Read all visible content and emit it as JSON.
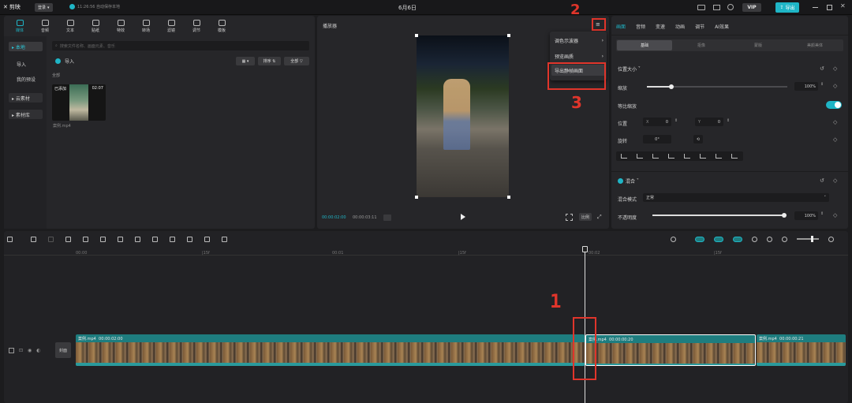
{
  "app": {
    "logo": "剪映",
    "user": "登录",
    "status": "11:26:56 自动保存本地",
    "title": "6月6日",
    "vip": "VIP",
    "export": "导出"
  },
  "media_tabs": [
    {
      "id": "media",
      "label": "媒体"
    },
    {
      "id": "audio",
      "label": "音频"
    },
    {
      "id": "text",
      "label": "文本"
    },
    {
      "id": "sticker",
      "label": "贴纸"
    },
    {
      "id": "effects",
      "label": "特效"
    },
    {
      "id": "transition",
      "label": "转场"
    },
    {
      "id": "filter",
      "label": "滤镜"
    },
    {
      "id": "adjust",
      "label": "调节"
    },
    {
      "id": "template",
      "label": "模板"
    }
  ],
  "media_sidebar": [
    "本地",
    "导入",
    "我的预设",
    "云素材",
    "素材库"
  ],
  "media": {
    "search_placeholder": "搜索文件名称、画面元素、音乐",
    "import": "导入",
    "sort": "排序",
    "filter_all": "全部",
    "section": "全部",
    "clip_badge": "已添加",
    "clip_duration": "02:07",
    "clip_name": "案例.mp4"
  },
  "player": {
    "title": "播放器",
    "time_current": "00:00:02:00",
    "time_total": "00:00:03:11",
    "ratio": "比例"
  },
  "player_menu": {
    "items": [
      "调色示波器",
      "预览画质",
      "导出静帧画面"
    ]
  },
  "inspector": {
    "tabs": [
      "画面",
      "音频",
      "变速",
      "动画",
      "调节",
      "AI效果"
    ],
    "subtabs": [
      "基础",
      "抠像",
      "蒙版",
      "美颜美体"
    ],
    "position_section": "位置大小",
    "scale_label": "缩放",
    "scale_value": "100%",
    "uniform_scale": "等比缩放",
    "position_label": "位置",
    "pos_x": "0",
    "pos_y": "0",
    "rotate_label": "旋转",
    "rotate_value": "0°",
    "blend_section": "混合",
    "blend_mode_label": "混合模式",
    "blend_mode_value": "正常",
    "opacity_label": "不透明度",
    "opacity_value": "100%"
  },
  "timeline": {
    "ticks": [
      "00:00",
      "|15f",
      "00:01",
      "|15f",
      "00:02",
      "|15f"
    ],
    "clips": [
      {
        "name": "案例.mp4",
        "duration": "00:00:02:00"
      },
      {
        "name": "案例.mp4",
        "duration": "00:00:00:20"
      },
      {
        "name": "案例.mp4",
        "duration": "00:00:00:21"
      }
    ],
    "cover": "封面"
  },
  "annotations": [
    "1",
    "2",
    "3"
  ],
  "colors": {
    "accent": "#1fb5c6",
    "highlight": "#e0352b",
    "clip_teal": "#1e7d7f"
  }
}
